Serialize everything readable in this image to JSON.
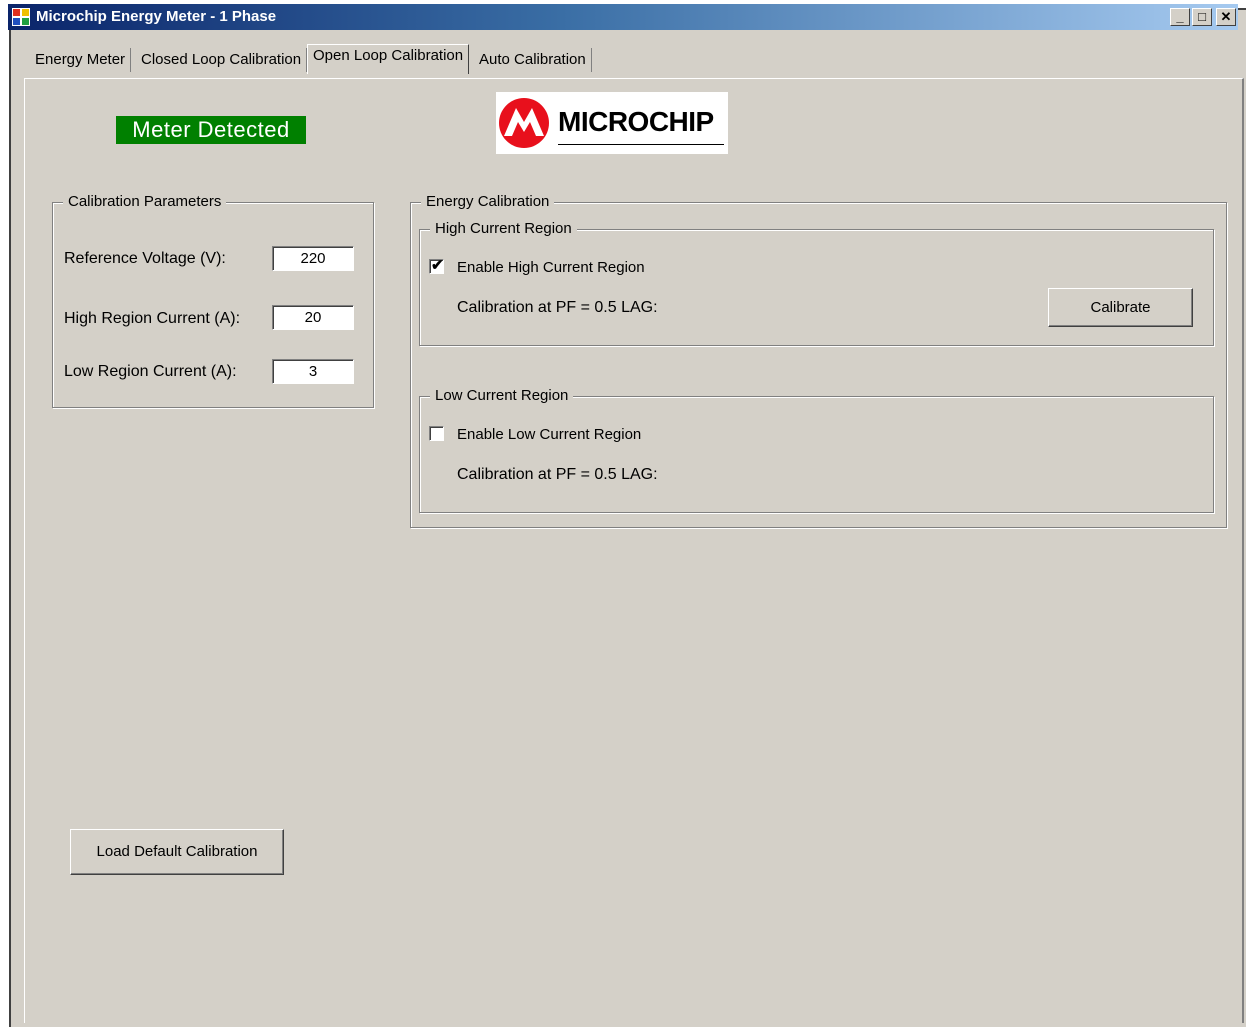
{
  "window": {
    "title": "Microchip Energy Meter - 1 Phase"
  },
  "tabs": [
    {
      "label": "Energy Meter"
    },
    {
      "label": "Closed Loop Calibration"
    },
    {
      "label": "Open Loop Calibration"
    },
    {
      "label": "Auto Calibration"
    }
  ],
  "active_tab": "Open Loop Calibration",
  "status_text": "Meter Detected",
  "logo_text": "MICROCHIP",
  "calibration_parameters": {
    "title": "Calibration Parameters",
    "reference_voltage_label": "Reference Voltage (V):",
    "reference_voltage_value": "220",
    "high_region_current_label": "High Region Current (A):",
    "high_region_current_value": "20",
    "low_region_current_label": "Low Region Current (A):",
    "low_region_current_value": "3"
  },
  "energy_calibration": {
    "title": "Energy Calibration",
    "high_region": {
      "title": "High Current Region",
      "enable_label": "Enable High Current Region",
      "enabled": true,
      "calibration_label": "Calibration at PF = 0.5 LAG:",
      "calibrate_button": "Calibrate"
    },
    "low_region": {
      "title": "Low Current Region",
      "enable_label": "Enable Low Current Region",
      "enabled": false,
      "calibration_label": "Calibration at PF = 0.5 LAG:"
    }
  },
  "load_default_button": "Load Default Calibration"
}
